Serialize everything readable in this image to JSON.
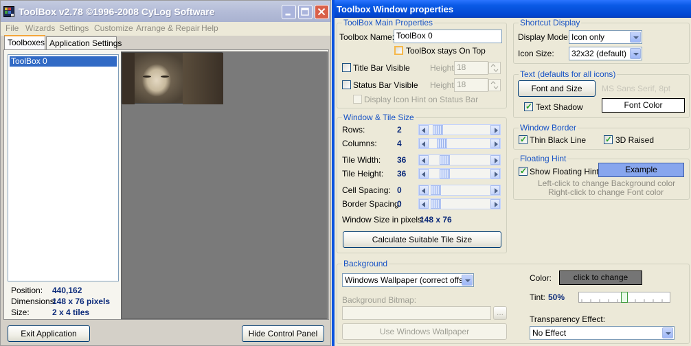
{
  "left_window": {
    "title": "ToolBox v2.78 ©1996-2008 CyLog Software",
    "menu": [
      "File",
      "Wizards",
      "Settings",
      "Customize",
      "Arrange & Repair",
      "Help"
    ],
    "tabs": [
      "Toolboxes",
      "Application Settings"
    ],
    "list_items": [
      "ToolBox 0"
    ],
    "stats": {
      "position_label": "Position:",
      "position_value": "440,162",
      "dimensions_label": "Dimensions:",
      "dimensions_value": "148 x 76 pixels",
      "size_label": "Size:",
      "size_value": "2 x 4 tiles"
    },
    "buttons": {
      "exit": "Exit Application",
      "hide": "Hide Control Panel"
    }
  },
  "right_window": {
    "title": "Toolbox Window properties",
    "main_props": {
      "group_title": "ToolBox Main Properties",
      "name_label": "Toolbox Name:",
      "name_value": "ToolBox 0",
      "stays_on_top": "ToolBox stays On Top",
      "title_bar_visible": "Title Bar Visible",
      "status_bar_visible": "Status Bar Visible",
      "height_label": "Height:",
      "title_height": "18",
      "status_height": "18",
      "icon_hint_status": "Display Icon Hint on Status Bar"
    },
    "window_tile": {
      "group_title": "Window & Tile Size",
      "rows_label": "Rows:",
      "rows_value": "2",
      "columns_label": "Columns:",
      "columns_value": "4",
      "tile_width_label": "Tile Width:",
      "tile_width_value": "36",
      "tile_height_label": "Tile Height:",
      "tile_height_value": "36",
      "cell_spacing_label": "Cell Spacing:",
      "cell_spacing_value": "0",
      "border_spacing_label": "Border Spacing:",
      "border_spacing_value": "0",
      "window_size_label": "Window Size in pixels:",
      "window_size_value": "148 x 76",
      "calc_button": "Calculate Suitable Tile Size"
    },
    "shortcut_display": {
      "group_title": "Shortcut Display",
      "display_mode_label": "Display Mode:",
      "display_mode_value": "Icon only",
      "icon_size_label": "Icon Size:",
      "icon_size_value": "32x32 (default)"
    },
    "text_defaults": {
      "group_title": "Text (defaults for all icons)",
      "font_button": "Font and Size",
      "font_name": "MS Sans Serif, 8pt",
      "text_shadow": "Text Shadow",
      "font_color_button": "Font Color"
    },
    "window_border": {
      "group_title": "Window Border",
      "thin_black": "Thin Black Line",
      "raised_3d": "3D Raised"
    },
    "floating_hint": {
      "group_title": "Floating Hint",
      "show": "Show Floating Hint",
      "example": "Example",
      "hint_line1": "Left-click to change Background color",
      "hint_line2": "Right-click to change Font color",
      "example_color": "#88a6ee"
    },
    "background": {
      "group_title": "Background",
      "mode_value": "Windows Wallpaper (correct offset)",
      "bitmap_label": "Background Bitmap:",
      "browse": "...",
      "use_wallpaper": "Use Windows Wallpaper",
      "color_label": "Color:",
      "color_button": "click to change",
      "color_swatch": "#757575",
      "tint_label": "Tint:",
      "tint_value": "50%",
      "tint_fraction": 0.5,
      "transparency_label": "Transparency Effect:",
      "transparency_value": "No Effect"
    }
  }
}
